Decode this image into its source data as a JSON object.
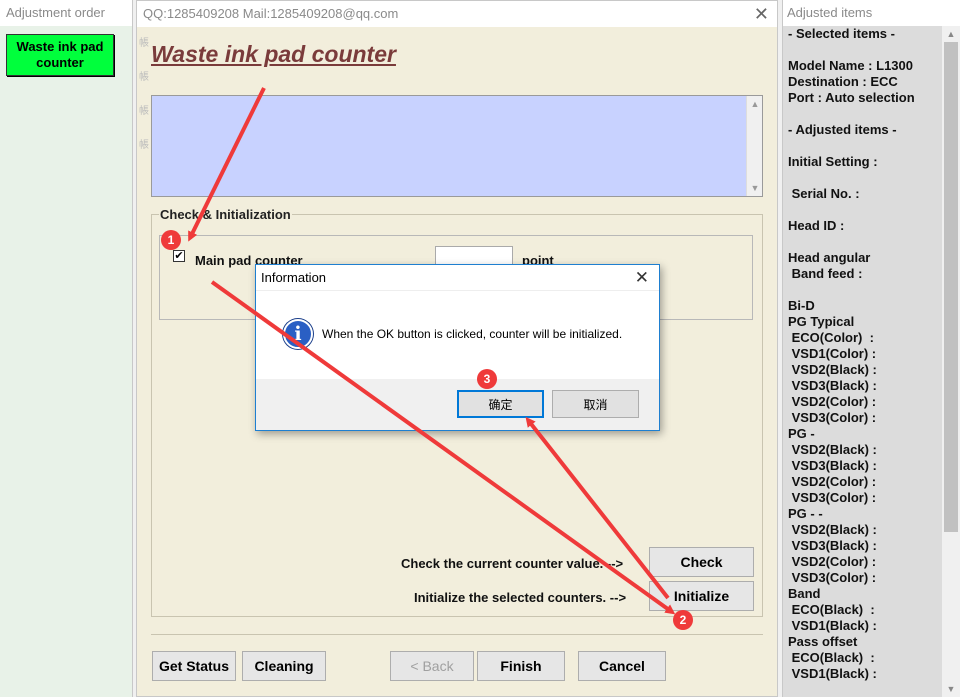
{
  "left_panel": {
    "title": "Adjustment order",
    "item_label": "Waste ink pad counter"
  },
  "main_window": {
    "title": "QQ:1285409208 Mail:1285409208@qq.com",
    "heading": "Waste ink pad counter",
    "group_label": "Check & Initialization",
    "main_pad_label": "Main pad counter",
    "main_pad_checked": true,
    "counter_value": "",
    "point_label": "point",
    "check_label": "Check the current counter value. -->",
    "check_button": "Check",
    "init_label": "Initialize the selected counters. -->",
    "init_button": "Initialize",
    "buttons": {
      "get_status": "Get Status",
      "cleaning": "Cleaning",
      "back": "< Back",
      "finish": "Finish",
      "cancel": "Cancel"
    }
  },
  "right_panel": {
    "title": "Adjusted items",
    "lines": [
      "- Selected items -",
      "",
      "Model Name : L1300",
      "Destination : ECC",
      "Port : Auto selection",
      "",
      "- Adjusted items -",
      "",
      "Initial Setting :",
      "",
      " Serial No. :",
      "",
      "Head ID :",
      "",
      "Head angular",
      " Band feed :",
      "",
      "Bi-D",
      "PG Typical",
      " ECO(Color)  :",
      " VSD1(Color) :",
      " VSD2(Black) :",
      " VSD3(Black) :",
      " VSD2(Color) :",
      " VSD3(Color) :",
      "PG -",
      " VSD2(Black) :",
      " VSD3(Black) :",
      " VSD2(Color) :",
      " VSD3(Color) :",
      "PG - -",
      " VSD2(Black) :",
      " VSD3(Black) :",
      " VSD2(Color) :",
      " VSD3(Color) :",
      "Band",
      " ECO(Black)  :",
      " VSD1(Black) :",
      "Pass offset",
      " ECO(Black)  :",
      " VSD1(Black) :"
    ]
  },
  "dialog": {
    "title": "Information",
    "message": "When the OK button is clicked, counter will be initialized.",
    "ok": "确定",
    "cancel": "取消",
    "icon": "info-icon"
  },
  "annotations": {
    "markers": [
      "1",
      "2",
      "3"
    ],
    "color": "#ef3a3a"
  }
}
